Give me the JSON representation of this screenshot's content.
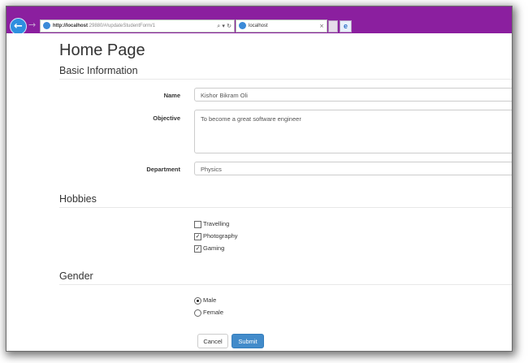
{
  "browser": {
    "address_host": "http://localhost",
    "address_rest": ":29880/#/updateStudentForm/1",
    "address_icons": "⌕ ▾ ↻",
    "tab_title": "localhost",
    "tab_close": "×",
    "back_icon": "←",
    "forward_icon": "→",
    "ie_icon": "e"
  },
  "page": {
    "title": "Home Page",
    "basic_info_heading": "Basic Information",
    "hobbies_heading": "Hobbies",
    "gender_heading": "Gender"
  },
  "form": {
    "name_label": "Name",
    "name_value": "Kishor Bikram Oli",
    "objective_label": "Objective",
    "objective_value": "To become a great software engineer",
    "department_label": "Department",
    "department_value": "Physics",
    "hobbies": [
      {
        "label": "Travelling",
        "checked": false
      },
      {
        "label": "Photography",
        "checked": true
      },
      {
        "label": "Gaming",
        "checked": true
      }
    ],
    "genders": [
      {
        "label": "Male",
        "selected": true
      },
      {
        "label": "Female",
        "selected": false
      }
    ],
    "check_mark": "✓",
    "cancel_label": "Cancel",
    "submit_label": "Submit"
  },
  "colors": {
    "titlebar": "#8b1f9f",
    "primary_button": "#428bca"
  }
}
